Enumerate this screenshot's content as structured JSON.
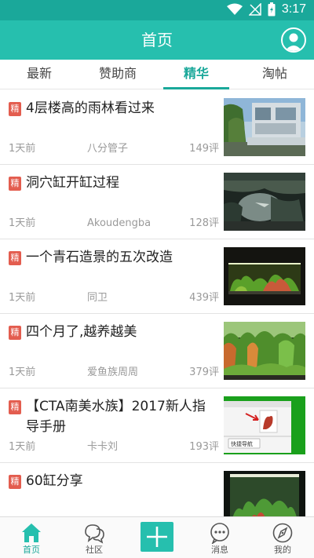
{
  "status_bar": {
    "time": "3:17"
  },
  "header": {
    "title": "首页"
  },
  "tabs": [
    {
      "label": "最新",
      "active": false
    },
    {
      "label": "赞助商",
      "active": false
    },
    {
      "label": "精华",
      "active": true
    },
    {
      "label": "淘帖",
      "active": false
    }
  ],
  "badge_label": "精",
  "posts": [
    {
      "title": "4层楼高的雨林看过来",
      "time": "1天前",
      "author": "八分管子",
      "comments": "149评"
    },
    {
      "title": "洞穴缸开缸过程",
      "time": "1天前",
      "author": "Akoudengba",
      "comments": "128评"
    },
    {
      "title": "一个青石造景的五次改造",
      "time": "1天前",
      "author": "同卫",
      "comments": "439评"
    },
    {
      "title": "四个月了,越养越美",
      "time": "1天前",
      "author": "爱鱼族周周",
      "comments": "379评"
    },
    {
      "title": "【CTA南美水族】2017新人指导手册",
      "time": "1天前",
      "author": "卡卡刘",
      "comments": "193评",
      "thumb_text": "快捷导航"
    },
    {
      "title": "60缸分享",
      "time": "",
      "author": "",
      "comments": ""
    }
  ],
  "bottom_nav": [
    {
      "label": "首页",
      "icon": "home-icon",
      "active": true
    },
    {
      "label": "社区",
      "icon": "chat-bubbles-icon",
      "active": false
    },
    {
      "label": "",
      "icon": "plus-icon",
      "active": false
    },
    {
      "label": "消息",
      "icon": "message-icon",
      "active": false
    },
    {
      "label": "我的",
      "icon": "compass-icon",
      "active": false
    }
  ],
  "colors": {
    "accent": "#26bfae",
    "status_bar": "#1aa89a",
    "badge": "#e35d4f"
  }
}
